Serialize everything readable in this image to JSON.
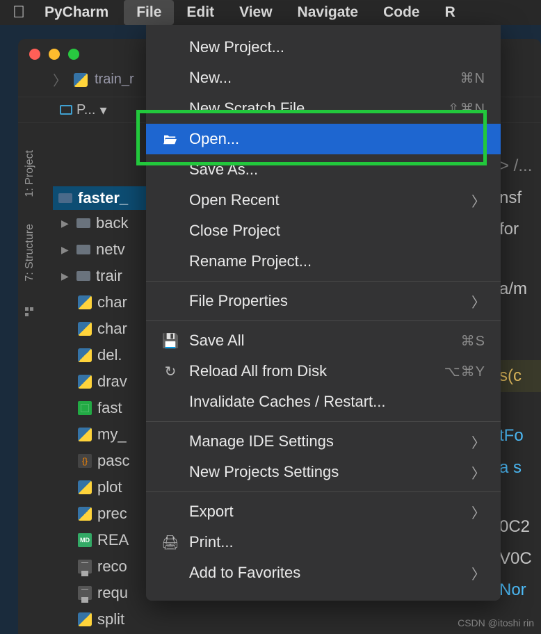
{
  "menubar": {
    "app": "PyCharm",
    "items": [
      "File",
      "Edit",
      "View",
      "Navigate",
      "Code",
      "R"
    ],
    "active_index": 0
  },
  "breadcrumb": {
    "file": "train_r"
  },
  "project_selector": {
    "label": "P...",
    "dropdown": "▾"
  },
  "side_tabs": {
    "project": "1: Project",
    "structure": "7: Structure"
  },
  "tree": {
    "root": "faster_",
    "folders": [
      {
        "name": "back",
        "expandable": true
      },
      {
        "name": "netv",
        "expandable": true
      },
      {
        "name": "trair",
        "expandable": true
      }
    ],
    "files": [
      {
        "name": "char",
        "type": "py"
      },
      {
        "name": "char",
        "type": "py"
      },
      {
        "name": "del.",
        "type": "py"
      },
      {
        "name": "drav",
        "type": "py"
      },
      {
        "name": "fast",
        "type": "img"
      },
      {
        "name": "my_",
        "type": "py"
      },
      {
        "name": "pasc",
        "type": "json"
      },
      {
        "name": "plot",
        "type": "py"
      },
      {
        "name": "prec",
        "type": "py"
      },
      {
        "name": "REA",
        "type": "md",
        "badge": "MD"
      },
      {
        "name": "reco",
        "type": "txt"
      },
      {
        "name": "requ",
        "type": "txt"
      },
      {
        "name": "split",
        "type": "py"
      }
    ]
  },
  "menu": {
    "items": [
      {
        "label": "New Project...",
        "icon": "",
        "shortcut": "",
        "submenu": false
      },
      {
        "label": "New...",
        "icon": "",
        "shortcut": "⌘N",
        "submenu": false
      },
      {
        "label": "New Scratch File",
        "icon": "",
        "shortcut": "⇧⌘N",
        "submenu": false
      },
      {
        "label": "Open...",
        "icon": "folder-open",
        "shortcut": "",
        "submenu": false,
        "highlighted": true
      },
      {
        "label": "Save As...",
        "icon": "",
        "shortcut": "",
        "submenu": false
      },
      {
        "label": "Open Recent",
        "icon": "",
        "shortcut": "",
        "submenu": true
      },
      {
        "label": "Close Project",
        "icon": "",
        "shortcut": "",
        "submenu": false
      },
      {
        "label": "Rename Project...",
        "icon": "",
        "shortcut": "",
        "submenu": false
      },
      {
        "sep": true
      },
      {
        "label": "File Properties",
        "icon": "",
        "shortcut": "",
        "submenu": true
      },
      {
        "sep": true
      },
      {
        "label": "Save All",
        "icon": "save",
        "shortcut": "⌘S",
        "submenu": false
      },
      {
        "label": "Reload All from Disk",
        "icon": "reload",
        "shortcut": "⌥⌘Y",
        "submenu": false
      },
      {
        "label": "Invalidate Caches / Restart...",
        "icon": "",
        "shortcut": "",
        "submenu": false
      },
      {
        "sep": true
      },
      {
        "label": "Manage IDE Settings",
        "icon": "",
        "shortcut": "",
        "submenu": true
      },
      {
        "label": "New Projects Settings",
        "icon": "",
        "shortcut": "",
        "submenu": true
      },
      {
        "sep": true
      },
      {
        "label": "Export",
        "icon": "",
        "shortcut": "",
        "submenu": true
      },
      {
        "label": "Print...",
        "icon": "print",
        "shortcut": "",
        "submenu": false
      },
      {
        "label": "Add to Favorites",
        "icon": "",
        "shortcut": "",
        "submenu": true
      }
    ]
  },
  "editor_hints": [
    "> /...",
    "nsf",
    "for",
    "a/m",
    "s(c",
    "tFo",
    "a s",
    "0C2",
    "V0C",
    "Nor"
  ],
  "watermark": "CSDN @itoshi rin"
}
